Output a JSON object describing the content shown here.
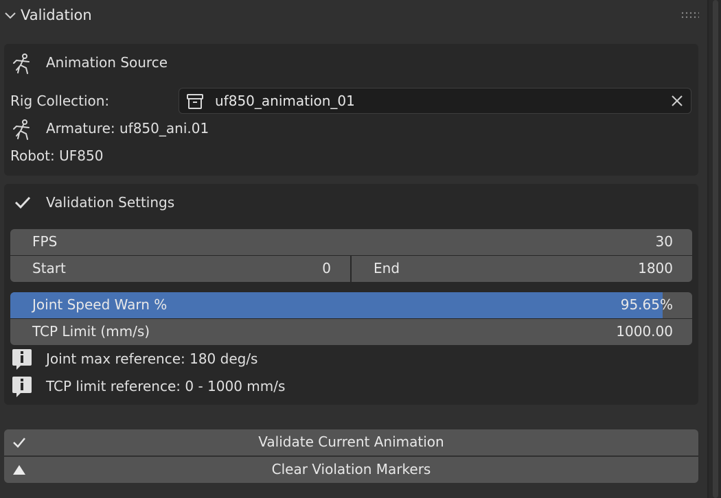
{
  "header": {
    "title": "Validation"
  },
  "animation_source": {
    "title": "Animation Source",
    "rig_collection_label": "Rig Collection:",
    "rig_collection_value": "uf850_animation_01",
    "armature": "Armature: uf850_ani.01",
    "robot": "Robot: UF850"
  },
  "validation_settings": {
    "title": "Validation Settings",
    "fps": {
      "label": "FPS",
      "value": "30"
    },
    "start": {
      "label": "Start",
      "value": "0"
    },
    "end": {
      "label": "End",
      "value": "1800"
    },
    "joint_speed_warn": {
      "label": "Joint Speed Warn %",
      "value": "95.65%",
      "fraction": 0.9565
    },
    "tcp_limit": {
      "label": "TCP Limit (mm/s)",
      "value": "1000.00"
    },
    "info_joint": "Joint max reference: 180 deg/s",
    "info_tcp": "TCP limit reference: 0 - 1000 mm/s"
  },
  "actions": {
    "validate": "Validate Current Animation",
    "clear": "Clear Violation Markers"
  },
  "colors": {
    "accent": "#4772b3",
    "panel": "#282828",
    "field": "#545454",
    "background": "#303030"
  }
}
